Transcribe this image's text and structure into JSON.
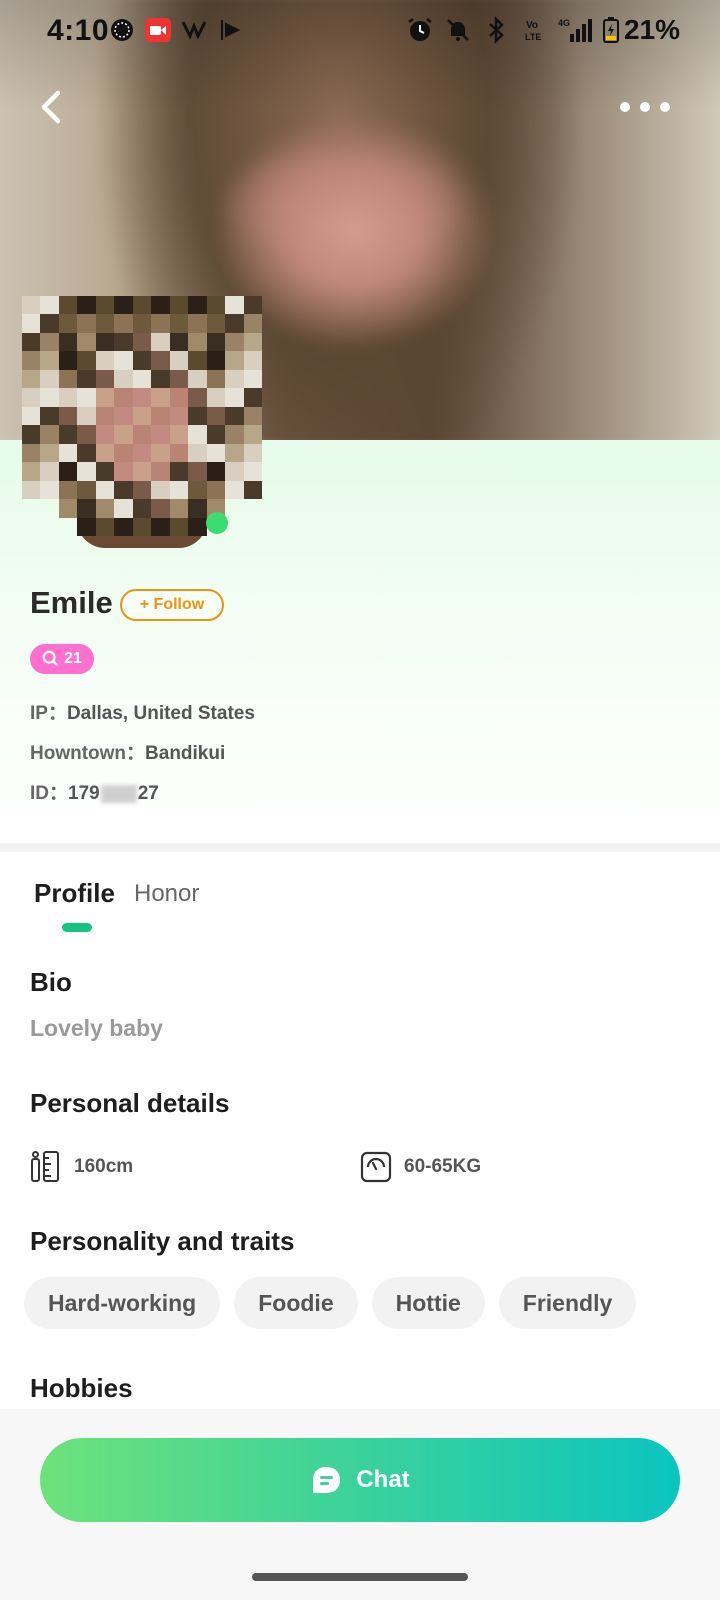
{
  "status_bar": {
    "time": "4:10",
    "battery": "21%"
  },
  "nav": {
    "back_icon": "chevron-left-icon",
    "more_icon": "more-horizontal-icon"
  },
  "profile": {
    "name": "Emile",
    "follow_label": "+ Follow",
    "level": "21",
    "ip_label": "IP：",
    "ip_value": "Dallas, United States",
    "hometown_label": "Howntown：",
    "hometown_value": "Bandikui",
    "id_label": "ID：",
    "id_prefix": "179",
    "id_suffix": "27"
  },
  "tabs": [
    {
      "label": "Profile",
      "active": true
    },
    {
      "label": "Honor",
      "active": false
    }
  ],
  "sections": {
    "bio_title": "Bio",
    "bio_text": "Lovely baby",
    "personal_title": "Personal details",
    "height": "160cm",
    "weight": "60-65KG",
    "traits_title": "Personality and traits",
    "traits": [
      "Hard-working",
      "Foodie",
      "Hottie",
      "Friendly"
    ],
    "hobbies_title": "Hobbies"
  },
  "actions": {
    "chat_label": "Chat"
  },
  "colors": {
    "accent_green": "#14c480",
    "follow_orange": "#f2930f",
    "level_pink": "#ff6fd0",
    "chat_gradient_start": "#6ee27a",
    "chat_gradient_end": "#0bc5bf"
  }
}
